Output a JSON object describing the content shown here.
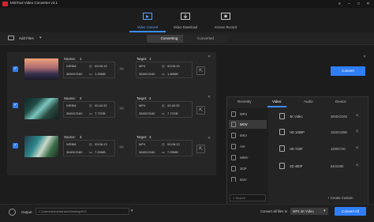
{
  "app": {
    "title": "MiniTool Video Converter v3.1"
  },
  "nav": [
    {
      "label": "Video Convert",
      "icon": "video-convert-icon"
    },
    {
      "label": "Video Download",
      "icon": "video-download-icon"
    },
    {
      "label": "Screen Record",
      "icon": "screen-record-icon"
    }
  ],
  "toolbar": {
    "add_files": "Add Files",
    "tabs": [
      "Converting",
      "Converted"
    ]
  },
  "tasks": [
    {
      "source_label": "Source:",
      "source_index": "1",
      "target_label": "Target:",
      "target_index": "1",
      "src_format": "WEBM",
      "src_duration": "00:05:19",
      "src_res": "3840X2160",
      "src_size": "1.25MB",
      "dst_format": "MP4",
      "dst_duration": "00:05:19",
      "dst_res": "3840X2160",
      "dst_size": "1.86MB",
      "convert": "Convert"
    },
    {
      "source_label": "Source:",
      "source_index": "2",
      "target_label": "Target:",
      "target_index": "2",
      "src_format": "WEBM",
      "src_duration": "00:40:32",
      "src_res": "3840X2160",
      "src_size": "7.72GB",
      "dst_format": "MP4",
      "dst_duration": "00:40:32",
      "dst_res": "3840X2160",
      "dst_size": "7.72GB"
    },
    {
      "source_label": "Source:",
      "source_index": "3",
      "target_label": "Target:",
      "target_index": "3",
      "src_format": "WEBM",
      "src_duration": "00:08:13",
      "src_res": "3840X2160",
      "src_size": "7.25MB",
      "dst_format": "MP4",
      "dst_duration": "00:08:13",
      "dst_res": "3840X2160",
      "dst_size": "7.25MB"
    }
  ],
  "panel": {
    "tabs": [
      "Recently",
      "Video",
      "Audio",
      "Device"
    ],
    "formats": [
      "MP4",
      "MOV",
      "MKV",
      "AVI",
      "WMV",
      "3GP",
      "M4V"
    ],
    "search_placeholder": "Search",
    "resolutions": [
      {
        "name": "4K Video",
        "res": "3840X2160"
      },
      {
        "name": "HD 1080P",
        "res": "1920X1080"
      },
      {
        "name": "HD 720P",
        "res": "1280X720"
      },
      {
        "name": "SD 480P",
        "res": "640X480"
      }
    ],
    "create_custom": "+ Create Custom"
  },
  "bottom": {
    "output_label": "Output",
    "output_path": "C:\\Users\\Administrator\\Desktop\\tt12",
    "convert_all_label": "Convert all files to",
    "convert_all_format": "MP4 4K Video",
    "convert_all_button": "Convert All"
  },
  "colors": {
    "accent": "#2f7ef5",
    "brand": "#d6252c"
  }
}
